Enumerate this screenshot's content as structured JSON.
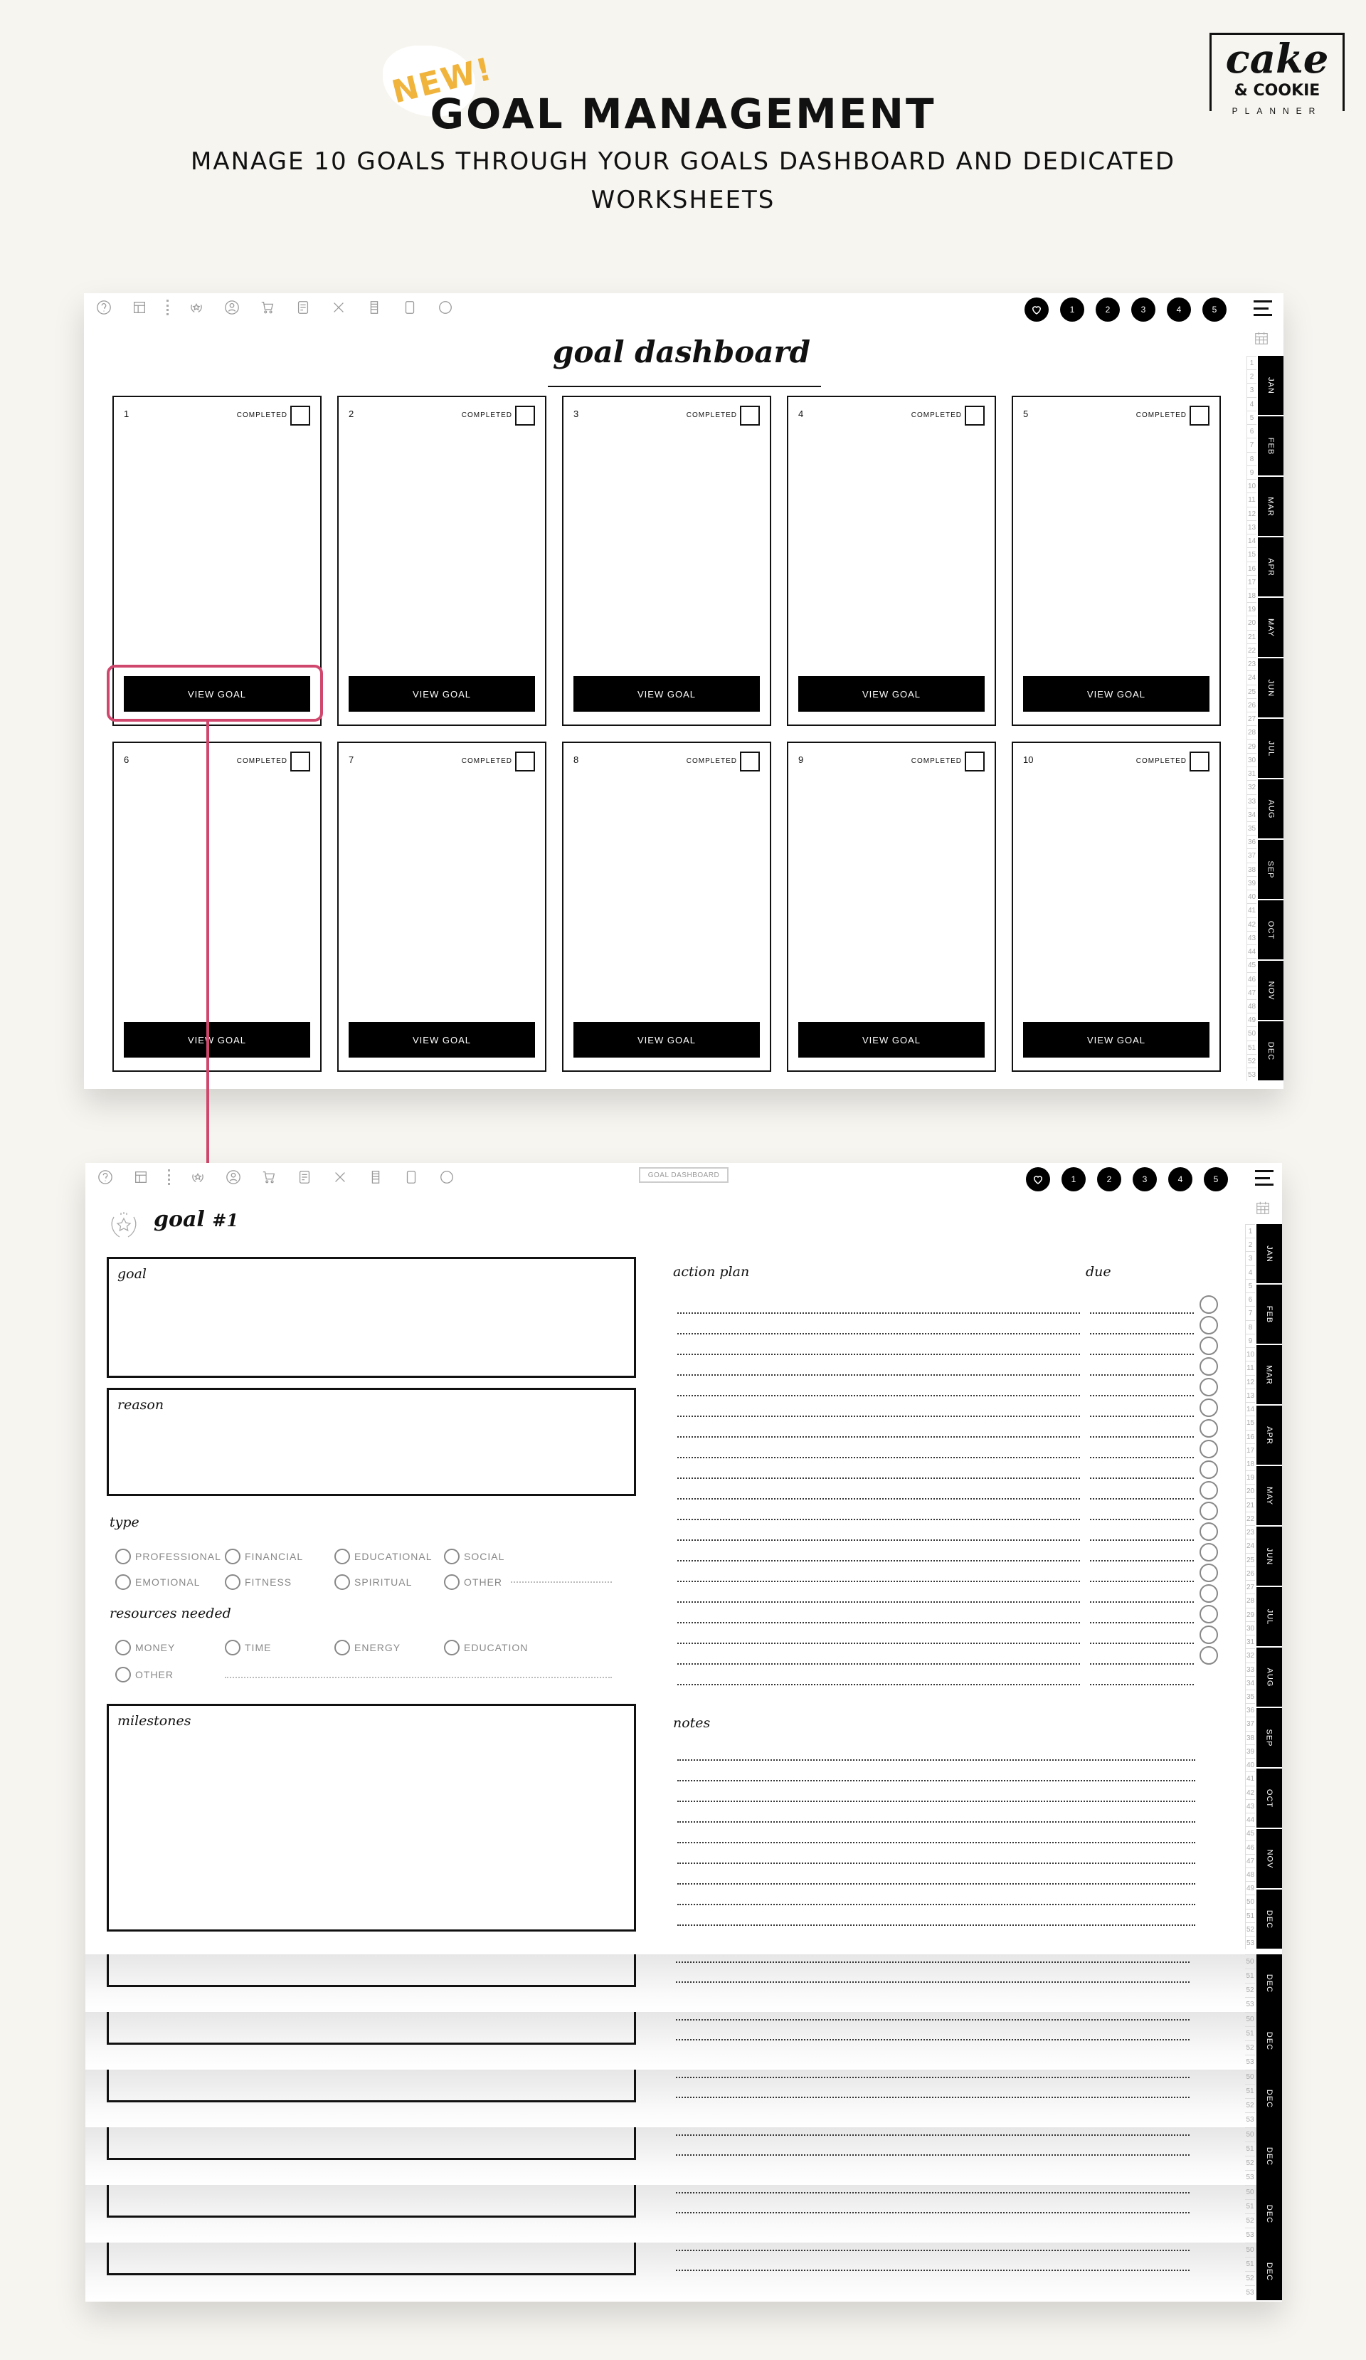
{
  "header": {
    "badge": "NEW!",
    "title": "GOAL MANAGEMENT",
    "subtitle": "MANAGE 10 GOALS THROUGH YOUR GOALS DASHBOARD AND DEDICATED WORKSHEETS",
    "logo": {
      "line1": "cake",
      "line2": "& COOKIE",
      "line3": "PLANNER"
    }
  },
  "colors": {
    "accent_highlight": "#d0476d",
    "badge": "#f0b43c",
    "background": "#f7f5f0"
  },
  "toolbar": {
    "icons": [
      "help-icon",
      "layout-icon",
      "more-dots-icon",
      "goals-wreath-icon",
      "profile-icon",
      "cart-icon",
      "checklist-icon",
      "recipe-icon",
      "notebook-icon",
      "journal-icon",
      "circle-icon"
    ],
    "nav_buttons": [
      "1",
      "2",
      "3",
      "4",
      "5"
    ],
    "goal_dashboard_button": "GOAL DASHBOARD"
  },
  "side_tabs": {
    "months": [
      "JAN",
      "FEB",
      "MAR",
      "APR",
      "MAY",
      "JUN",
      "JUL",
      "AUG",
      "SEP",
      "OCT",
      "NOV",
      "DEC"
    ],
    "weeks": [
      "1",
      "2",
      "3",
      "4",
      "5",
      "6",
      "7",
      "8",
      "9",
      "10",
      "11",
      "12",
      "13",
      "14",
      "15",
      "16",
      "17",
      "18",
      "19",
      "20",
      "21",
      "22",
      "23",
      "24",
      "25",
      "26",
      "27",
      "28",
      "29",
      "30",
      "31",
      "32",
      "33",
      "34",
      "35",
      "36",
      "37",
      "38",
      "39",
      "40",
      "41",
      "42",
      "43",
      "44",
      "45",
      "46",
      "47",
      "48",
      "49",
      "50",
      "51",
      "52",
      "53"
    ],
    "stacked_month": "DEC",
    "stacked_weeks": [
      "50",
      "51",
      "52",
      "53"
    ]
  },
  "dashboard": {
    "title": "goal dashboard",
    "completed_label": "COMPLETED",
    "view_label": "VIEW GOAL",
    "cards": [
      {
        "num": "1"
      },
      {
        "num": "2"
      },
      {
        "num": "3"
      },
      {
        "num": "4"
      },
      {
        "num": "5"
      },
      {
        "num": "6"
      },
      {
        "num": "7"
      },
      {
        "num": "8"
      },
      {
        "num": "9"
      },
      {
        "num": "10"
      }
    ]
  },
  "worksheet": {
    "title": "goal",
    "number": "#1",
    "goal_label": "goal",
    "reason_label": "reason",
    "type_label": "type",
    "type_options": [
      "PROFESSIONAL",
      "FINANCIAL",
      "EDUCATIONAL",
      "SOCIAL",
      "EMOTIONAL",
      "FITNESS",
      "SPIRITUAL",
      "OTHER"
    ],
    "resources_label": "resources needed",
    "resource_options": [
      "MONEY",
      "TIME",
      "ENERGY",
      "EDUCATION",
      "OTHER"
    ],
    "milestones_label": "milestones",
    "action_plan_label": "action plan",
    "due_label": "due",
    "action_rows": 19,
    "notes_label": "notes",
    "notes_rows": 9
  }
}
